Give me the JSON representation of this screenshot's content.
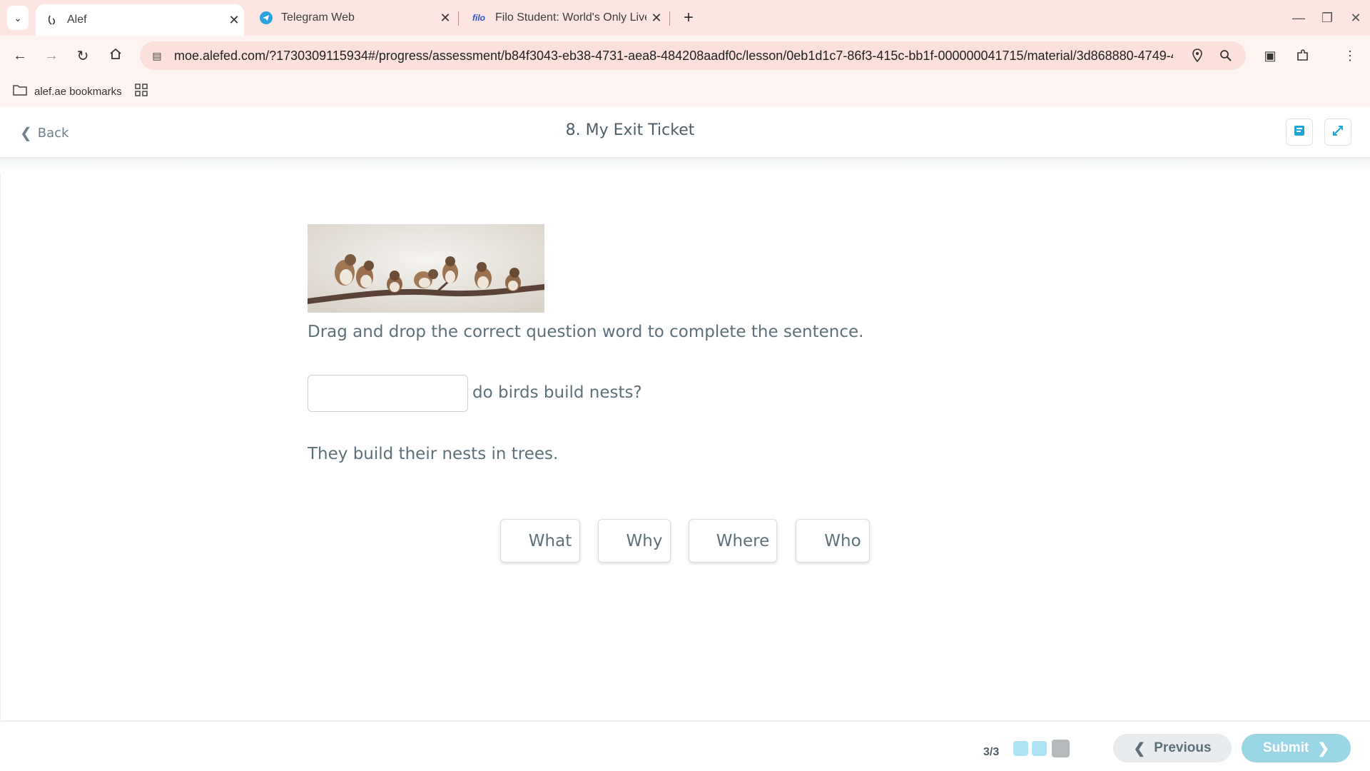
{
  "browser": {
    "tabs": [
      {
        "title": "Alef",
        "icon": "alef-icon",
        "active": true
      },
      {
        "title": "Telegram Web",
        "icon": "telegram-icon",
        "active": false
      },
      {
        "title": "Filo Student: World's Only Live I",
        "icon": "filo-icon",
        "favicon_text": "filo",
        "active": false
      }
    ],
    "url": "moe.alefed.com/?1730309115934#/progress/assessment/b84f3043-eb38-4731-aea8-484208aadf0c/lesson/0eb1d1c7-86f3-415c-bb1f-000000041715/material/3d868880-4749-4...",
    "bookmarks": {
      "folder_label": "alef.ae bookmarks"
    }
  },
  "app": {
    "back_label": "Back",
    "title": "8. My Exit Ticket"
  },
  "question": {
    "instruction": "Drag and drop the correct question word to complete the sentence.",
    "sentence": "do birds build nests?",
    "answer": "They build their nests in trees.",
    "choices": [
      "What",
      "Why",
      "Where",
      "Who"
    ]
  },
  "footer": {
    "progress": "3/3",
    "previous_label": "Previous",
    "submit_label": "Submit"
  },
  "colors": {
    "accent": "#1fa7d4",
    "submit": "#9ad6e6",
    "dot_done": "#aee3f3",
    "dot_current": "#b5babc"
  }
}
